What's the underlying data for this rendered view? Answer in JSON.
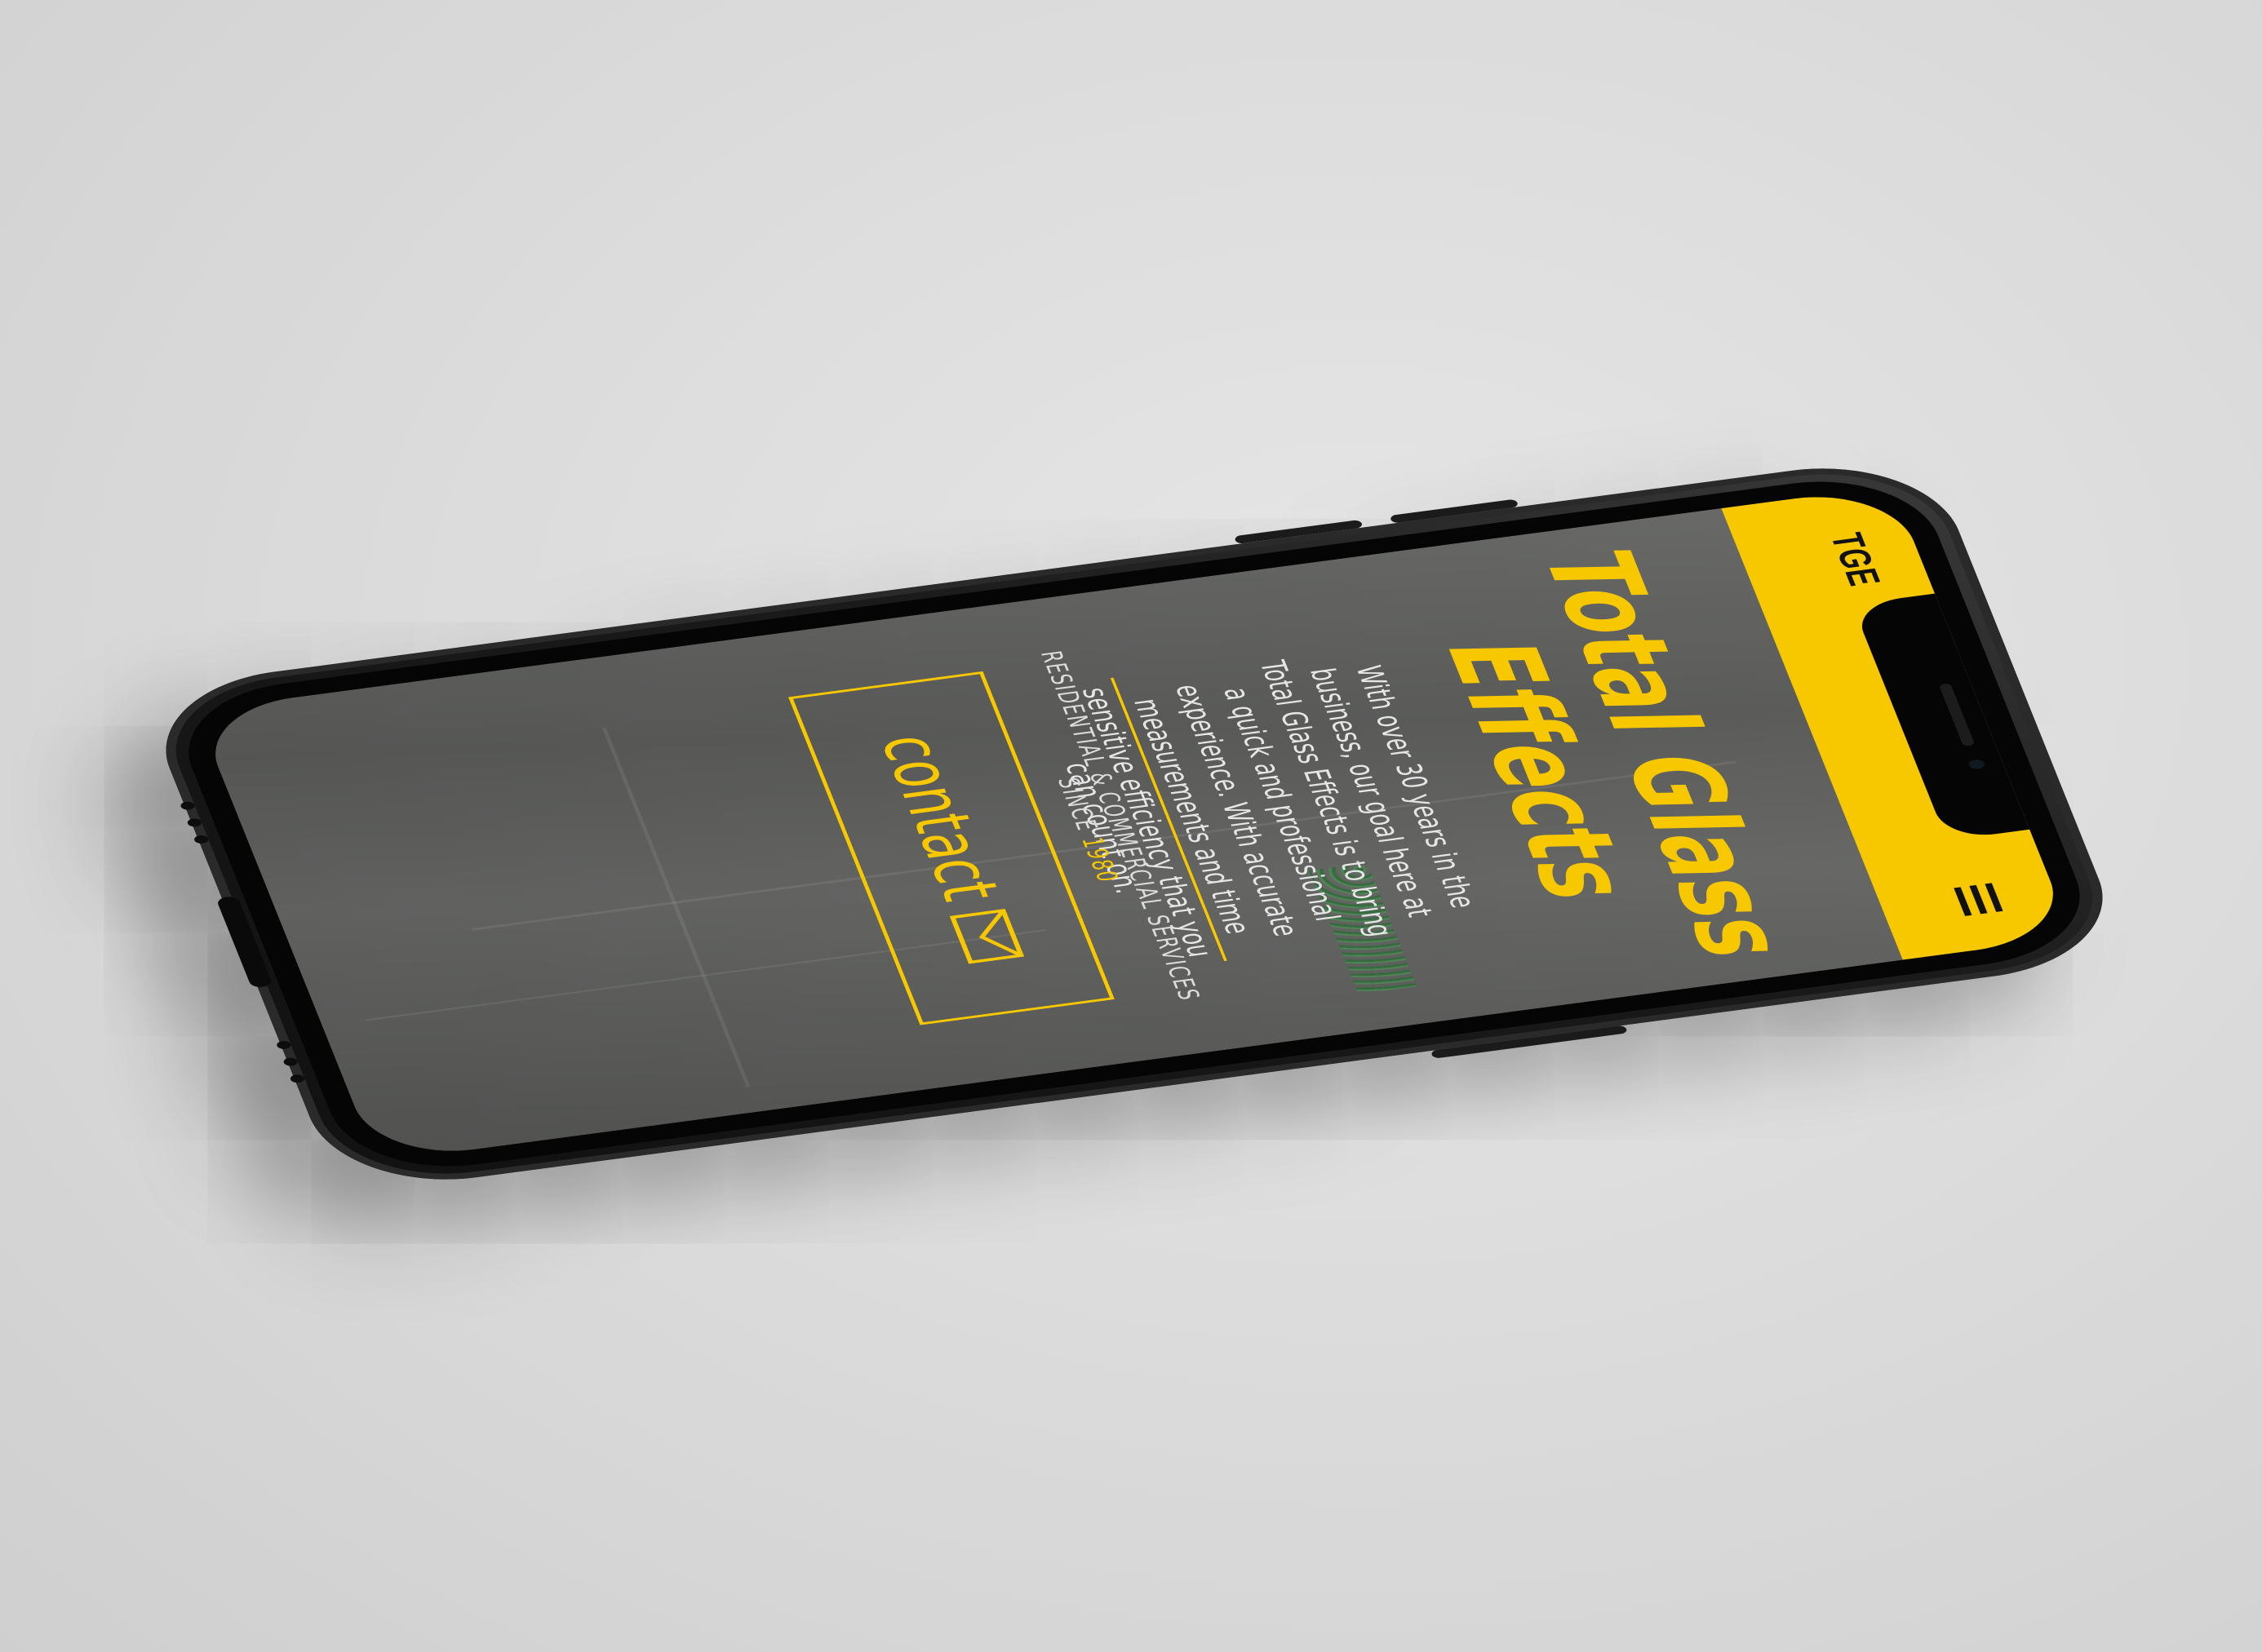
{
  "header": {
    "logo_text": "TGE",
    "menu_icon": "hamburger-menu-icon",
    "background_color": "#f7c800"
  },
  "hero": {
    "title": "Total Glass Effects",
    "description": "With over 30 years in the business, our goal here at Total Glass Effects is to bring a quick and professional experience. With accurate measurements and time sensitive efficiency that you can count on.",
    "tagline": "RESIDENTIAL  & COMMERCIAL  SERVICES SINCE",
    "tagline_year": "1980",
    "accent_color": "#f7c800"
  },
  "contact": {
    "label": "contact",
    "icon": "envelope-icon"
  }
}
